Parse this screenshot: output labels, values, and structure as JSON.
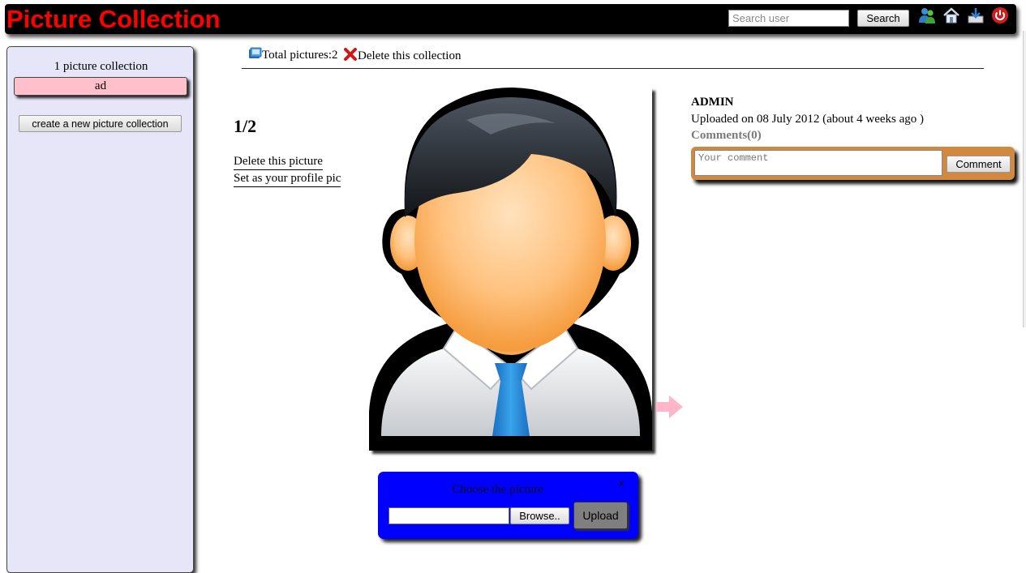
{
  "header": {
    "title": "Picture Collection",
    "search_placeholder": "Search user",
    "search_label": "Search",
    "icons": [
      "users-icon",
      "home-icon",
      "download-icon",
      "power-icon"
    ]
  },
  "sidebar": {
    "collection_count": "1 picture collection",
    "collections": [
      {
        "label": "ad"
      }
    ],
    "create_label": "create a new picture collection"
  },
  "toolbar": {
    "total_label": "Total pictures:2",
    "delete_collection_label": "Delete this collection"
  },
  "picture": {
    "counter": "1/2",
    "delete_label": "Delete this picture",
    "profile_label": "Set as your profile pic"
  },
  "meta": {
    "uploader": "ADMIN",
    "uploaded": "Uploaded on 08 July 2012 (about 4 weeks ago )",
    "comments": "Comments(0)"
  },
  "comment": {
    "placeholder": "Your comment",
    "button": "Comment"
  },
  "upload": {
    "title": "Choose the picture",
    "close": "x",
    "browse": "Browse..",
    "button": "Upload"
  },
  "colors": {
    "title": "#ff0000",
    "sidebar_bg": "#e6e6f8",
    "collection_item": "#ffc0cb",
    "comment_panel": "#d2883f",
    "upload_panel": "#0000ff",
    "next_arrow": "#ffb6c8"
  }
}
